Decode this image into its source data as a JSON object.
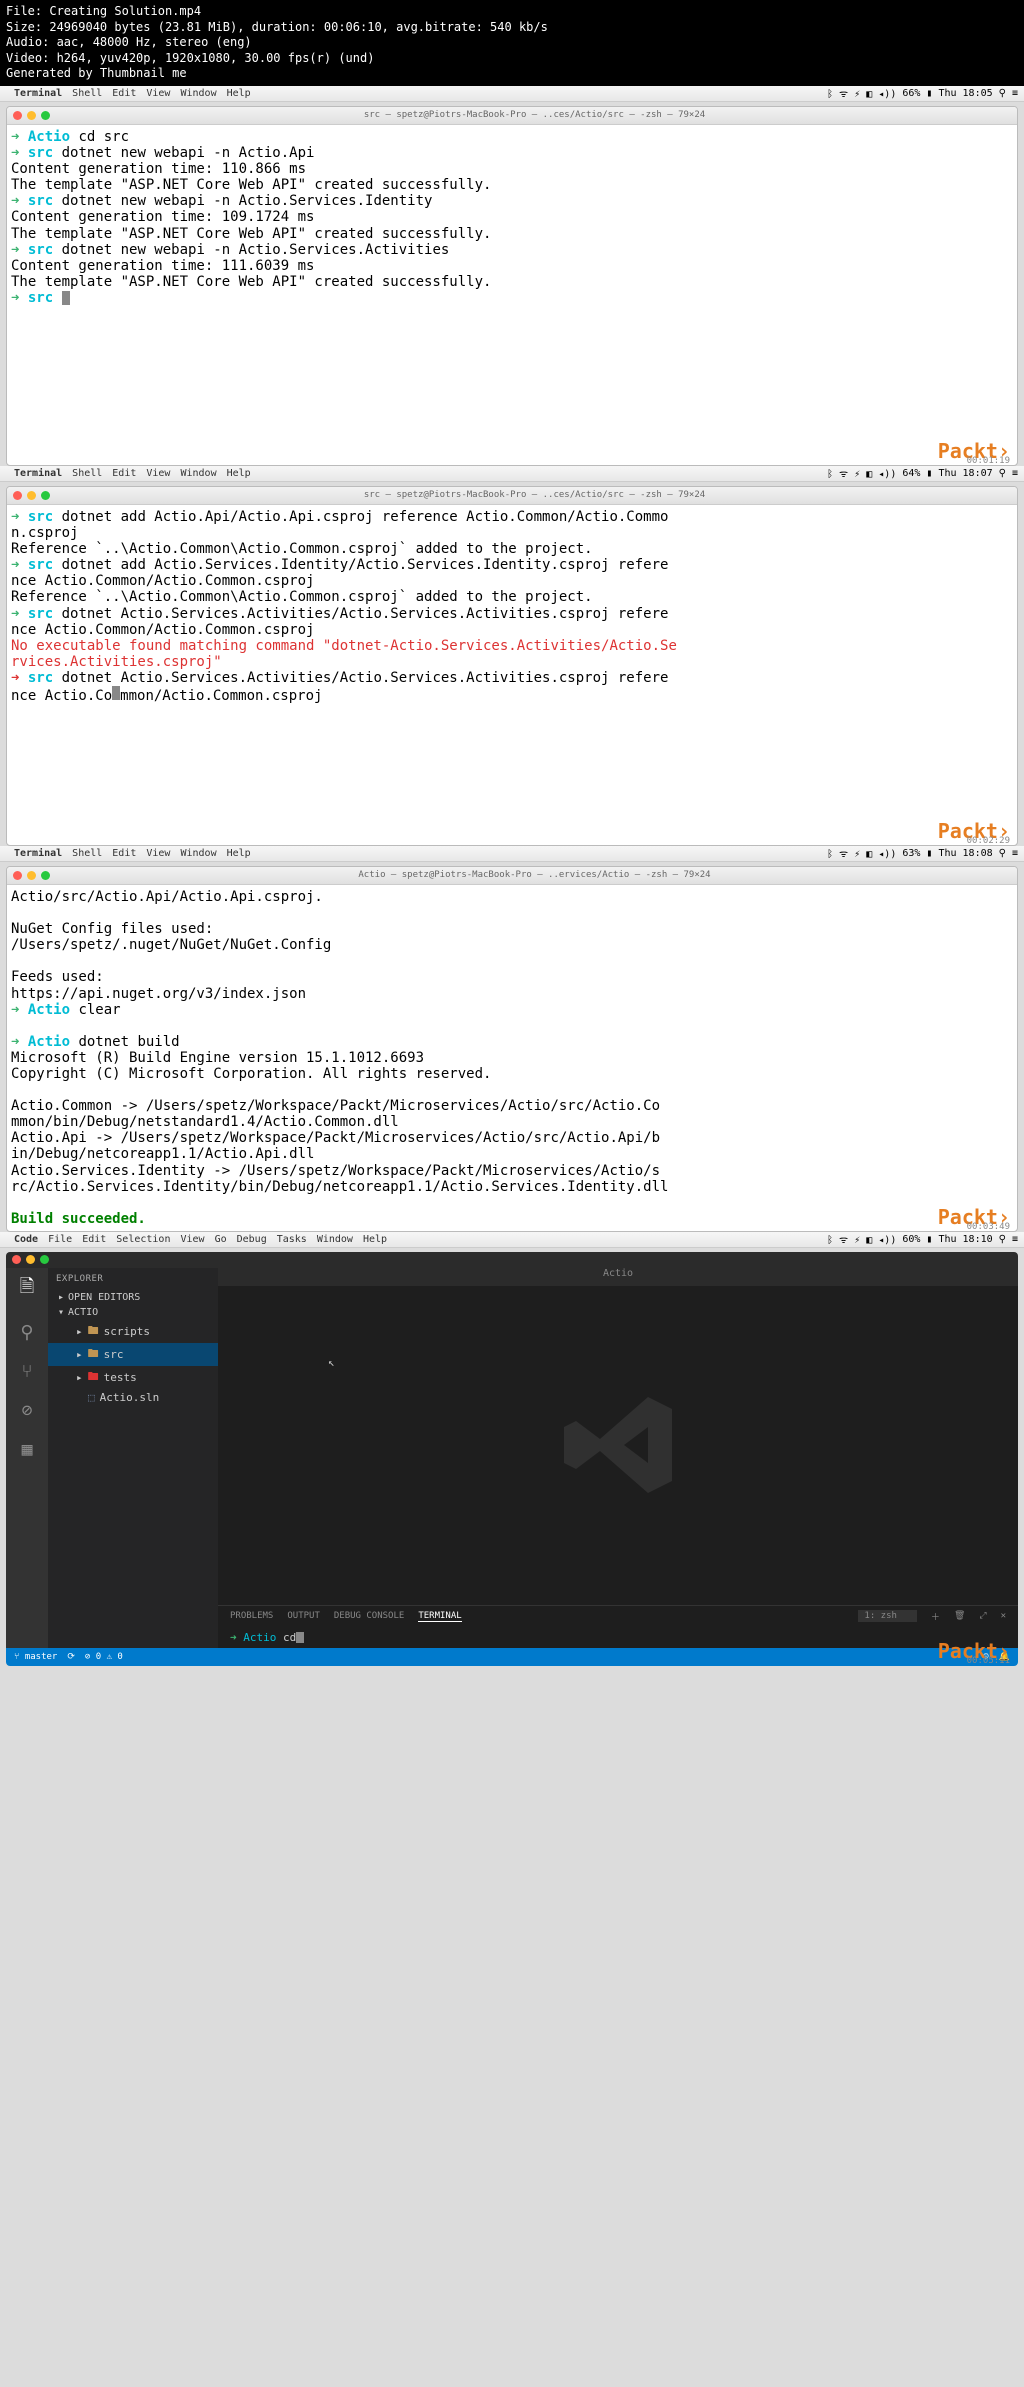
{
  "video_info": {
    "file": "File: Creating Solution.mp4",
    "size": "Size: 24969040 bytes (23.81 MiB), duration: 00:06:10, avg.bitrate: 540 kb/s",
    "audio": "Audio: aac, 48000 Hz, stereo (eng)",
    "video": "Video: h264, yuv420p, 1920x1080, 30.00 fps(r) (und)",
    "gen": "Generated by Thumbnail me"
  },
  "menubar": {
    "app_term": "Terminal",
    "app_code": "Code",
    "items_term": [
      "Shell",
      "Edit",
      "View",
      "Window",
      "Help"
    ],
    "items_code": [
      "File",
      "Edit",
      "Selection",
      "View",
      "Go",
      "Debug",
      "Tasks",
      "Window",
      "Help"
    ],
    "batt1": "66%",
    "time1": "Thu 18:05",
    "batt2": "64%",
    "time2": "Thu 18:07",
    "batt3": "63%",
    "time3": "Thu 18:08",
    "batt4": "60%",
    "time4": "Thu 18:10"
  },
  "term_title1": "src — spetz@Piotrs-MacBook-Pro — ..ces/Actio/src — -zsh — 79×24",
  "term_title2": "src — spetz@Piotrs-MacBook-Pro — ..ces/Actio/src — -zsh — 79×24",
  "term_title3": "Actio — spetz@Piotrs-MacBook-Pro — ..ervices/Actio — -zsh — 79×24",
  "s1": {
    "l1_dir": "Actio",
    "l1_cmd": " cd src",
    "l2_dir": "src",
    "l2_cmd": " dotnet new webapi -n Actio.Api",
    "l3": "Content generation time: 110.866 ms",
    "l4": "The template \"ASP.NET Core Web API\" created successfully.",
    "l5_dir": "src",
    "l5_cmd": " dotnet new webapi -n Actio.Services.Identity",
    "l6": "Content generation time: 109.1724 ms",
    "l7": "The template \"ASP.NET Core Web API\" created successfully.",
    "l8_dir": "src",
    "l8_cmd": " dotnet new webapi -n Actio.Services.Activities",
    "l9": "Content generation time: 111.6039 ms",
    "l10": "The template \"ASP.NET Core Web API\" created successfully.",
    "l11_dir": "src"
  },
  "s2": {
    "l1_dir": "src",
    "l1_cmd": " dotnet add Actio.Api/Actio.Api.csproj reference Actio.Common/Actio.Commo",
    "l2": "n.csproj",
    "l3": "Reference `..\\Actio.Common\\Actio.Common.csproj` added to the project.",
    "l4_dir": "src",
    "l4_cmd": " dotnet add Actio.Services.Identity/Actio.Services.Identity.csproj refere",
    "l5": "nce Actio.Common/Actio.Common.csproj",
    "l6": "Reference `..\\Actio.Common\\Actio.Common.csproj` added to the project.",
    "l7_dir": "src",
    "l7_cmd": " dotnet Actio.Services.Activities/Actio.Services.Activities.csproj refere",
    "l8": "nce Actio.Common/Actio.Common.csproj",
    "l9a": "No executable found matching command \"dotnet-Actio.Services.Activities/Actio.Se",
    "l9b": "rvices.Activities.csproj\"",
    "l10_dir": "src",
    "l10_cmd": " dotnet Actio.Services.Activities/Actio.Services.Activities.csproj refere",
    "l11a": "nce Actio.Co",
    "l11b": "mmon/Actio.Common.csproj"
  },
  "s3": {
    "l1": "Actio/src/Actio.Api/Actio.Api.csproj.",
    "l2": "  NuGet Config files used:",
    "l3": "      /Users/spetz/.nuget/NuGet/NuGet.Config",
    "l4": "  Feeds used:",
    "l5": "      https://api.nuget.org/v3/index.json",
    "l6_dir": "Actio",
    "l6_cmd": " clear",
    "l7_dir": "Actio",
    "l7_cmd": " dotnet build",
    "l8": "Microsoft (R) Build Engine version 15.1.1012.6693",
    "l9": "Copyright (C) Microsoft Corporation. All rights reserved.",
    "l10": "  Actio.Common -> /Users/spetz/Workspace/Packt/Microservices/Actio/src/Actio.Co",
    "l11": "mmon/bin/Debug/netstandard1.4/Actio.Common.dll",
    "l12": "  Actio.Api -> /Users/spetz/Workspace/Packt/Microservices/Actio/src/Actio.Api/b",
    "l13": "in/Debug/netcoreapp1.1/Actio.Api.dll",
    "l14": "  Actio.Services.Identity -> /Users/spetz/Workspace/Packt/Microservices/Actio/s",
    "l15": "rc/Actio.Services.Identity/bin/Debug/netcoreapp1.1/Actio.Services.Identity.dll",
    "l16": "Build succeeded."
  },
  "vscode": {
    "title": "Actio",
    "explorer": "EXPLORER",
    "open_editors": "OPEN EDITORS",
    "root": "ACTIO",
    "items": {
      "scripts": "scripts",
      "src": "src",
      "tests": "tests",
      "sln": "Actio.sln"
    },
    "panel": {
      "problems": "PROBLEMS",
      "output": "OUTPUT",
      "debug": "DEBUG CONSOLE",
      "terminal": "TERMINAL",
      "shell": "1: zsh",
      "prompt_dir": "Actio",
      "prompt_cmd": " cd"
    },
    "status": {
      "branch": "master"
    }
  },
  "brand": "Packt›",
  "tc1": "00:01:19",
  "tc2": "00:02:29",
  "tc3": "00:03:49",
  "tc4": "00:05:11"
}
